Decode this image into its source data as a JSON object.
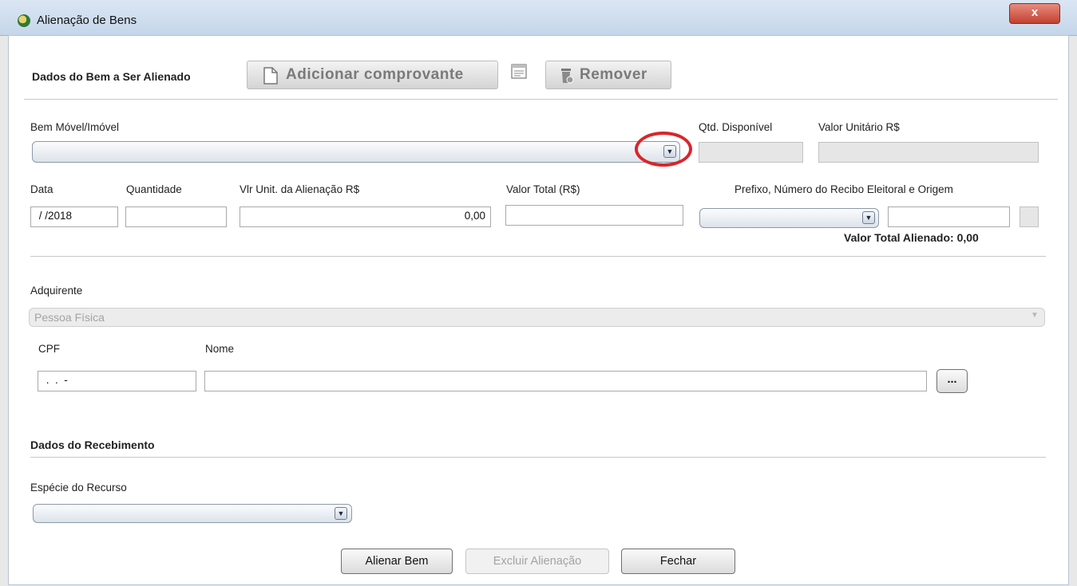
{
  "window": {
    "title": "Alienação de Bens",
    "close_label": "x"
  },
  "bem_section": {
    "title": "Dados do Bem a Ser Alienado",
    "add_label": "Adicionar comprovante",
    "remove_label": "Remover"
  },
  "bem": {
    "movel_label": "Bem Móvel/Imóvel",
    "movel_value": "",
    "qtd_label": "Qtd. Disponível",
    "qtd_value": "",
    "valor_unit_label": "Valor Unitário R$",
    "valor_unit_value": ""
  },
  "details": {
    "data_label": "Data",
    "data_value": " / /2018",
    "quantidade_label": "Quantidade",
    "quantidade_value": "",
    "vlr_unit_label": "Vlr Unit. da Alienação R$",
    "vlr_unit_value": "0,00",
    "valor_total_label": "Valor Total (R$)",
    "valor_total_value": "",
    "prefixo_label": "Prefixo, Número do Recibo Eleitoral e Origem",
    "prefixo_value": "",
    "recibo_value": "",
    "total_alienado_label": "Valor Total Alienado: 0,00"
  },
  "adquirente": {
    "label": "Adquirente",
    "tipo_value": "Pessoa Física",
    "cpf_label": "CPF",
    "cpf_value": " .  .  -",
    "nome_label": "Nome",
    "nome_value": "",
    "search_label": "..."
  },
  "recebimento": {
    "title": "Dados do Recebimento",
    "especie_label": "Espécie do Recurso",
    "especie_value": ""
  },
  "actions": {
    "alienar_label": "Alienar Bem",
    "excluir_label": "Excluir Alienação",
    "fechar_label": "Fechar"
  },
  "colors": {
    "highlight_circle": "#d8262c"
  },
  "icons": [
    "app-emblem-icon",
    "document-icon",
    "receipt-icon",
    "trash-icon",
    "dropdown-arrow-icon"
  ]
}
